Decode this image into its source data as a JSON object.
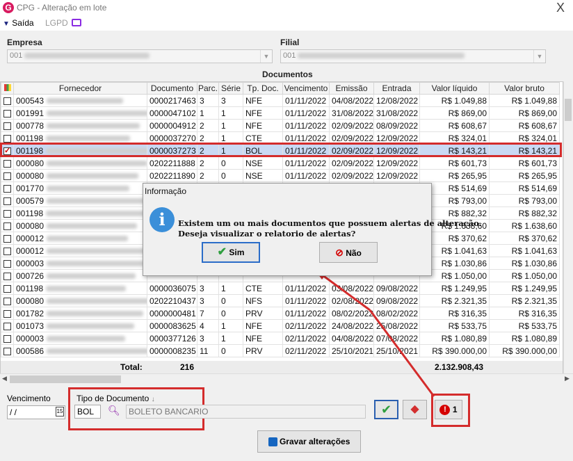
{
  "window": {
    "title": "CPG - Alteração em lote",
    "close": "X"
  },
  "menu": {
    "saida": "Saída",
    "lgpd": "LGPD"
  },
  "empresa": {
    "label": "Empresa",
    "value": "001"
  },
  "filial": {
    "label": "Filial",
    "value": "001"
  },
  "documentos_label": "Documentos",
  "columns": [
    "",
    "Fornecedor",
    "Documento",
    "Parc.",
    "Série",
    "Tp. Doc.",
    "Vencimento",
    "Emissão",
    "Entrada",
    "Valor líquido",
    "Valor bruto"
  ],
  "rows": [
    {
      "checked": false,
      "cod": "000543",
      "doc": "0000217463",
      "parc": "3",
      "serie": "3",
      "tp": "NFE",
      "venc": "01/11/2022",
      "emis": "04/08/2022",
      "ent": "12/08/2022",
      "liq": "R$ 1.049,88",
      "bruto": "R$ 1.049,88"
    },
    {
      "checked": false,
      "cod": "001991",
      "doc": "0000047102",
      "parc": "1",
      "serie": "1",
      "tp": "NFE",
      "venc": "01/11/2022",
      "emis": "31/08/2022",
      "ent": "31/08/2022",
      "liq": "R$ 869,00",
      "bruto": "R$ 869,00"
    },
    {
      "checked": false,
      "cod": "000778",
      "doc": "0000004912",
      "parc": "2",
      "serie": "1",
      "tp": "NFE",
      "venc": "01/11/2022",
      "emis": "02/09/2022",
      "ent": "08/09/2022",
      "liq": "R$ 608,67",
      "bruto": "R$ 608,67"
    },
    {
      "checked": false,
      "cod": "001198",
      "doc": "0000037270",
      "parc": "2",
      "serie": "1",
      "tp": "CTE",
      "venc": "01/11/2022",
      "emis": "02/09/2022",
      "ent": "12/09/2022",
      "liq": "R$ 324,01",
      "bruto": "R$ 324,01"
    },
    {
      "checked": true,
      "cod": "001198",
      "doc": "0000037273",
      "parc": "2",
      "serie": "1",
      "tp": "BOL",
      "venc": "01/11/2022",
      "emis": "02/09/2022",
      "ent": "12/09/2022",
      "liq": "R$ 143,21",
      "bruto": "R$ 143,21"
    },
    {
      "checked": false,
      "cod": "000080",
      "doc": "0202211888",
      "parc": "2",
      "serie": "0",
      "tp": "NSE",
      "venc": "01/11/2022",
      "emis": "02/09/2022",
      "ent": "12/09/2022",
      "liq": "R$ 601,73",
      "bruto": "R$ 601,73"
    },
    {
      "checked": false,
      "cod": "000080",
      "doc": "0202211890",
      "parc": "2",
      "serie": "0",
      "tp": "NSE",
      "venc": "01/11/2022",
      "emis": "02/09/2022",
      "ent": "12/09/2022",
      "liq": "R$ 265,95",
      "bruto": "R$ 265,95"
    },
    {
      "checked": false,
      "cod": "001770",
      "doc": "",
      "parc": "",
      "serie": "",
      "tp": "",
      "venc": "",
      "emis": "",
      "ent": "",
      "liq": "R$ 514,69",
      "bruto": "R$ 514,69"
    },
    {
      "checked": false,
      "cod": "000579",
      "doc": "",
      "parc": "",
      "serie": "",
      "tp": "",
      "venc": "",
      "emis": "",
      "ent": "",
      "liq": "R$ 793,00",
      "bruto": "R$ 793,00"
    },
    {
      "checked": false,
      "cod": "001198",
      "doc": "",
      "parc": "",
      "serie": "",
      "tp": "",
      "venc": "",
      "emis": "",
      "ent": "",
      "liq": "R$ 882,32",
      "bruto": "R$ 882,32"
    },
    {
      "checked": false,
      "cod": "000080",
      "doc": "",
      "parc": "",
      "serie": "",
      "tp": "",
      "venc": "",
      "emis": "",
      "ent": "",
      "liq": "R$ 1.638,60",
      "bruto": "R$ 1.638,60"
    },
    {
      "checked": false,
      "cod": "000012",
      "doc": "",
      "parc": "",
      "serie": "",
      "tp": "",
      "venc": "",
      "emis": "",
      "ent": "",
      "liq": "R$ 370,62",
      "bruto": "R$ 370,62"
    },
    {
      "checked": false,
      "cod": "000012",
      "doc": "",
      "parc": "",
      "serie": "",
      "tp": "",
      "venc": "",
      "emis": "",
      "ent": "",
      "liq": "R$ 1.041,63",
      "bruto": "R$ 1.041,63"
    },
    {
      "checked": false,
      "cod": "000003",
      "doc": "",
      "parc": "",
      "serie": "",
      "tp": "",
      "venc": "",
      "emis": "",
      "ent": "",
      "liq": "R$ 1.030,86",
      "bruto": "R$ 1.030,86"
    },
    {
      "checked": false,
      "cod": "000726",
      "doc": "",
      "parc": "",
      "serie": "",
      "tp": "",
      "venc": "",
      "emis": "",
      "ent": "",
      "liq": "R$ 1.050,00",
      "bruto": "R$ 1.050,00"
    },
    {
      "checked": false,
      "cod": "001198",
      "doc": "0000036075",
      "parc": "3",
      "serie": "1",
      "tp": "CTE",
      "venc": "01/11/2022",
      "emis": "03/08/2022",
      "ent": "09/08/2022",
      "liq": "R$ 1.249,95",
      "bruto": "R$ 1.249,95"
    },
    {
      "checked": false,
      "cod": "000080",
      "doc": "0202210437",
      "parc": "3",
      "serie": "0",
      "tp": "NFS",
      "venc": "01/11/2022",
      "emis": "02/08/2022",
      "ent": "09/08/2022",
      "liq": "R$ 2.321,35",
      "bruto": "R$ 2.321,35"
    },
    {
      "checked": false,
      "cod": "001782",
      "doc": "0000000481",
      "parc": "7",
      "serie": "0",
      "tp": "PRV",
      "venc": "01/11/2022",
      "emis": "08/02/2022",
      "ent": "08/02/2022",
      "liq": "R$ 316,35",
      "bruto": "R$ 316,35"
    },
    {
      "checked": false,
      "cod": "001073",
      "doc": "0000083625",
      "parc": "4",
      "serie": "1",
      "tp": "NFE",
      "venc": "02/11/2022",
      "emis": "24/08/2022",
      "ent": "25/08/2022",
      "liq": "R$ 533,75",
      "bruto": "R$ 533,75"
    },
    {
      "checked": false,
      "cod": "000003",
      "doc": "0000377126",
      "parc": "3",
      "serie": "1",
      "tp": "NFE",
      "venc": "02/11/2022",
      "emis": "04/08/2022",
      "ent": "07/08/2022",
      "liq": "R$ 1.080,89",
      "bruto": "R$ 1.080,89"
    },
    {
      "checked": false,
      "cod": "000586",
      "doc": "0000008235",
      "parc": "11",
      "serie": "0",
      "tp": "PRV",
      "venc": "02/11/2022",
      "emis": "25/10/2021",
      "ent": "25/10/2021",
      "liq": "R$ 390.000,00",
      "bruto": "R$ 390.000,00"
    }
  ],
  "totals": {
    "label": "Total:",
    "parc": "216",
    "liquido": "2.132.908,43"
  },
  "bottom": {
    "venc_label": "Vencimento",
    "venc_value": " /  /",
    "cal_day": "15",
    "tipo_label": "Tipo de Documento",
    "tipo_code": "BOL",
    "tipo_desc": "BOLETO BANCARIO",
    "alert_count": "1",
    "gravar_label": "Gravar alterações"
  },
  "dialog": {
    "title": "Informação",
    "line1": "Existem um ou mais documentos que possuem alertas de alteração.",
    "line2": "Deseja visualizar o relatorio de alertas?",
    "sim": "Sim",
    "nao": "Não"
  },
  "colors": {
    "highlight": "#d42c2c",
    "selected_row": "#c9d9f3",
    "info_blue": "#3b8fd9"
  }
}
